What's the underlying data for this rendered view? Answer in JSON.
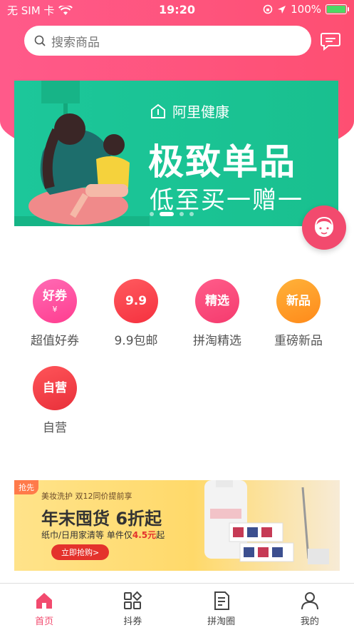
{
  "status_bar": {
    "carrier": "无 SIM 卡",
    "time": "19:20",
    "battery": "100%",
    "battery_level": 1.0
  },
  "search": {
    "placeholder": "搜索商品"
  },
  "banner": {
    "brand": "阿里健康",
    "headline": "极致单品",
    "subline": "低至买一赠一",
    "slide_count": 4,
    "active_slide": 1
  },
  "categories": [
    {
      "label": "超值好券",
      "icon_text": "好券",
      "icon_sub": "¥",
      "color_from": "#ff6bb5",
      "color_to": "#ff3d8f",
      "icon": "coupon-icon"
    },
    {
      "label": "9.9包邮",
      "icon_text": "9.9",
      "icon_sub": "",
      "color_from": "#ff5a5f",
      "color_to": "#f5313f",
      "icon": "shopping-bag-icon"
    },
    {
      "label": "拼淘精选",
      "icon_text": "精选",
      "icon_sub": "",
      "color_from": "#ff5c8a",
      "color_to": "#f53b6e",
      "icon": "trophy-icon"
    },
    {
      "label": "重磅新品",
      "icon_text": "新品",
      "icon_sub": "",
      "color_from": "#ffb23a",
      "color_to": "#ff8a1a",
      "icon": "new-box-icon"
    },
    {
      "label": "自营",
      "icon_text": "自营",
      "icon_sub": "",
      "color_from": "#ff5459",
      "color_to": "#e8303a",
      "icon": "store-icon"
    }
  ],
  "promo": {
    "badge": "抢先",
    "small": "美妆洗护  双12同价提前享",
    "title": "年末囤货 6折起",
    "desc_prefix": "纸巾/日用家清等 单件仅",
    "desc_price": "4.5元",
    "desc_suffix": "起",
    "cta": "立即抢购>"
  },
  "tabs": [
    {
      "label": "首页",
      "icon": "home-icon",
      "active": true
    },
    {
      "label": "抖券",
      "icon": "grid-icon",
      "active": false
    },
    {
      "label": "拼淘圈",
      "icon": "note-icon",
      "active": false
    },
    {
      "label": "我的",
      "icon": "user-icon",
      "active": false
    }
  ],
  "colors": {
    "accent": "#f24a6e",
    "banner": "#1cc79a"
  }
}
